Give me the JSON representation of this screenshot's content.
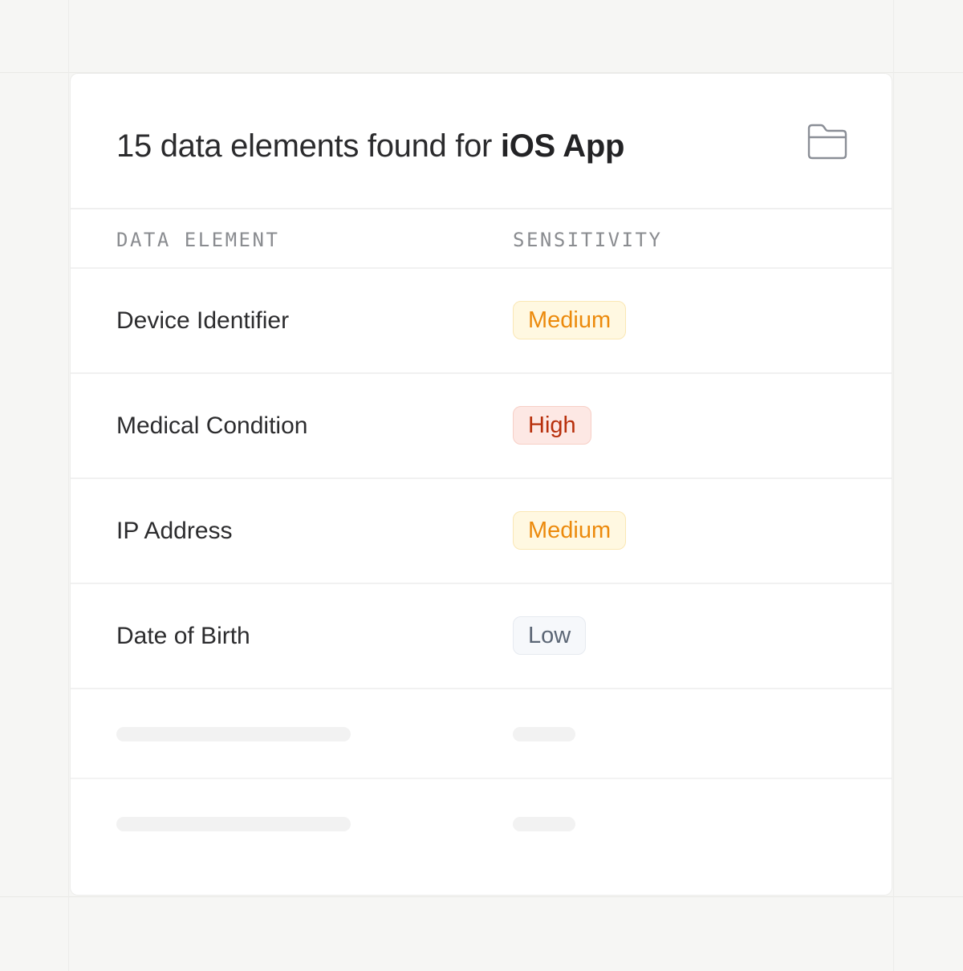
{
  "header": {
    "title_prefix": "15 data elements found for",
    "app_name": "iOS App",
    "folder_icon": "folder-icon"
  },
  "table": {
    "columns": [
      "DATA ELEMENT",
      "SENSITIVITY"
    ],
    "rows": [
      {
        "name": "Device Identifier",
        "sensitivity": "Medium"
      },
      {
        "name": "Medical Condition",
        "sensitivity": "High"
      },
      {
        "name": "IP Address",
        "sensitivity": "Medium"
      },
      {
        "name": "Date of Birth",
        "sensitivity": "Low"
      }
    ]
  },
  "colors": {
    "medium": "#ec8a0c",
    "high": "#b8300c",
    "low": "#5b6675",
    "background": "#f6f6f4",
    "card": "#ffffff"
  }
}
